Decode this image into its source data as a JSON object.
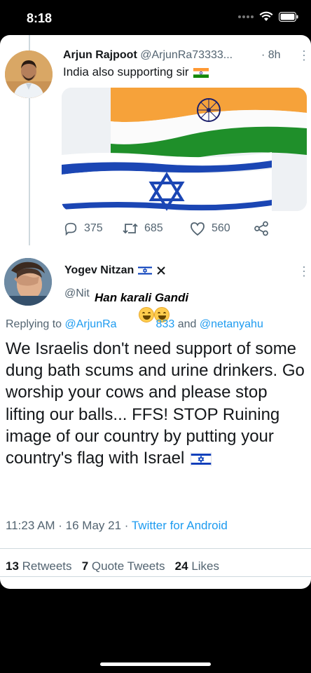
{
  "status_bar": {
    "time": "8:18"
  },
  "tweet1": {
    "name": "Arjun Rajpoot",
    "handle": "@ArjunRa73333...",
    "time": "· 8h",
    "text": "India also supporting sir",
    "replies": "375",
    "retweets": "685",
    "likes": "560"
  },
  "tweet2": {
    "name": "Yogev Nitzan",
    "handle": "@Nit",
    "replying_prefix": "Replying to",
    "replying_user1": "@ArjunRa",
    "replying_user1_tail": "833",
    "replying_and": "and",
    "replying_user2": "@netanyahu",
    "text": "We Israelis don't need support of some dung bath scums and urine drinkers. Go worship your cows and please stop lifting our balls... FFS! STOP Ruining image of our country by putting your country's flag with Israel",
    "time_date": "11:23 AM · 16 May 21 · ",
    "source": "Twitter for Android",
    "retweets_count": "13",
    "retweets_label": "Retweets",
    "quote_count": "7",
    "quote_label": "Quote Tweets",
    "likes_count": "24",
    "likes_label": "Likes"
  },
  "overlay": {
    "caption": "Han karali Gandi"
  },
  "colors": {
    "link": "#1d9bf0",
    "secondary": "#536471",
    "india_saffron": "#ff9933",
    "india_green": "#138808",
    "israel_blue": "#0038b8"
  },
  "icons": [
    "wifi-icon",
    "battery-icon",
    "more-icon",
    "reply-icon",
    "retweet-icon",
    "like-icon",
    "share-icon",
    "laughing-emoji"
  ]
}
